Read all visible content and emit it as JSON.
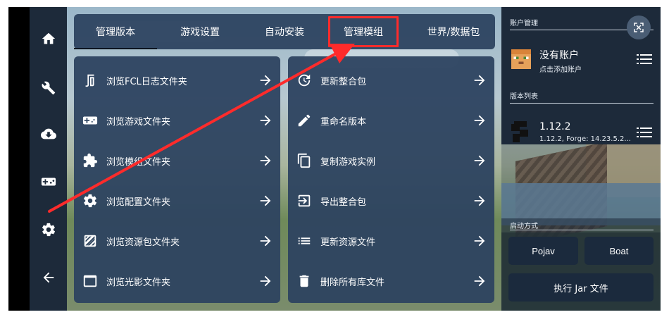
{
  "tabs": [
    {
      "label": "管理版本",
      "active": true
    },
    {
      "label": "游戏设置",
      "active": false
    },
    {
      "label": "自动安装",
      "active": false
    },
    {
      "label": "管理模组",
      "active": false,
      "highlighted": true
    },
    {
      "label": "世界/数据包",
      "active": false
    }
  ],
  "left_panel": [
    {
      "label": "浏览FCL日志文件夹",
      "icon": "log-folder-icon"
    },
    {
      "label": "浏览游戏文件夹",
      "icon": "gamepad-icon"
    },
    {
      "label": "浏览模组文件夹",
      "icon": "puzzle-icon"
    },
    {
      "label": "浏览配置文件夹",
      "icon": "gear-icon"
    },
    {
      "label": "浏览资源包文件夹",
      "icon": "texture-icon"
    },
    {
      "label": "浏览光影文件夹",
      "icon": "window-icon"
    }
  ],
  "right_panel": [
    {
      "label": "更新整合包",
      "icon": "update-icon"
    },
    {
      "label": "重命名版本",
      "icon": "pencil-icon"
    },
    {
      "label": "复制游戏实例",
      "icon": "copy-icon"
    },
    {
      "label": "导出整合包",
      "icon": "export-icon"
    },
    {
      "label": "更新资源文件",
      "icon": "list-icon"
    },
    {
      "label": "删除所有库文件",
      "icon": "trash-icon"
    }
  ],
  "sidebar": {
    "account_section": "账户管理",
    "account_name": "没有账户",
    "account_hint": "点击添加账户",
    "version_section": "版本列表",
    "version_name": "1.12.2",
    "version_detail": "1.12.2, Forge: 14.23.5.2...",
    "launch_section": "启动方式",
    "pojav_label": "Pojav",
    "boat_label": "Boat",
    "jar_label": "执行 Jar 文件"
  },
  "colors": {
    "panel": "#2d4360",
    "sidebar": "#1d2a3a",
    "highlight": "#ff2b2b"
  }
}
